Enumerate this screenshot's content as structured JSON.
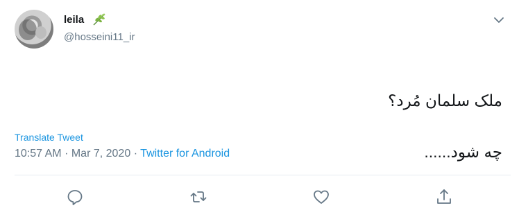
{
  "user": {
    "display_name": "leila",
    "handle": "@hosseini11_ir"
  },
  "tweet": {
    "text_line1": "ملک سلمان مُرد؟",
    "text_line2": "چه شود......",
    "translate_label": "Translate Tweet",
    "time": "10:57 AM",
    "separator1": "·",
    "date": "Mar 7, 2020",
    "separator2": "·",
    "source": "Twitter for Android"
  },
  "icons": {
    "leaf": "leaf-emoji-icon",
    "chevron": "chevron-down-icon",
    "reply": "reply-icon",
    "retweet": "retweet-icon",
    "like": "heart-icon",
    "share": "share-icon"
  },
  "colors": {
    "link": "#1b95e0",
    "secondary": "#657786",
    "text": "#14171a"
  }
}
